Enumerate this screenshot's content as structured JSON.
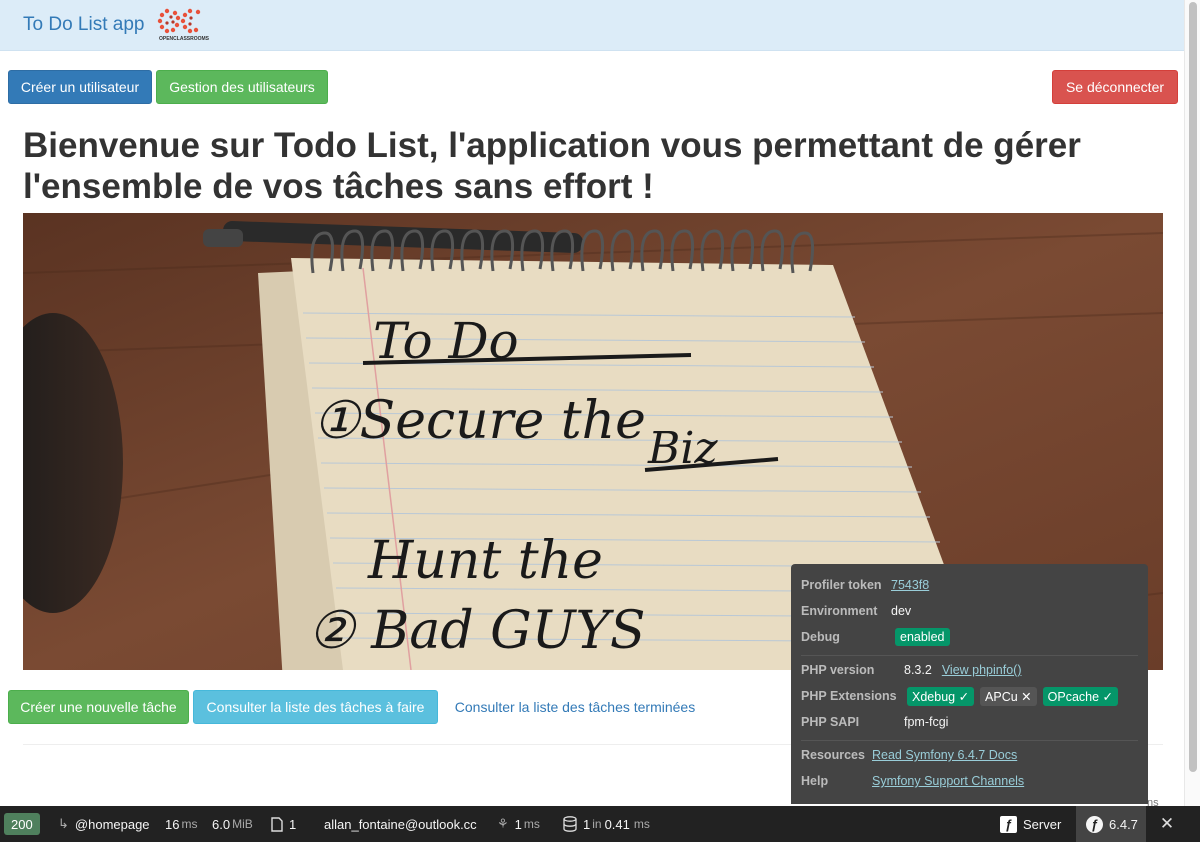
{
  "navbar": {
    "brand": "To Do List app",
    "logo_text": "OPENCLASSROOMS"
  },
  "actions": {
    "create_user": "Créer un utilisateur",
    "manage_users": "Gestion des utilisateurs",
    "logout": "Se déconnecter"
  },
  "main": {
    "title_line1": "Bienvenue sur Todo List, l'application vous permettant de gérer",
    "title_line2": "l'ensemble de vos tâches sans effort !",
    "image_text": {
      "line1": "To Do",
      "line2": "①Secure the",
      "line3": "Biz",
      "line4": "Hunt the",
      "line5": "② Bad GUYS"
    }
  },
  "task_actions": {
    "new_task": "Créer une nouvelle tâche",
    "todo_list": "Consulter la liste des tâches à faire",
    "done_list": "Consulter la liste des tâches terminées"
  },
  "footer_fragment": "ns",
  "profiler_panel": {
    "token_label": "Profiler token",
    "token_value": "7543f8",
    "environment_label": "Environment",
    "environment_value": "dev",
    "debug_label": "Debug",
    "debug_value": "enabled",
    "php_version_label": "PHP version",
    "php_version_value": "8.3.2",
    "phpinfo_link": "View phpinfo()",
    "php_extensions_label": "PHP Extensions",
    "extensions": [
      {
        "label": "Xdebug ✓",
        "status": "enabled"
      },
      {
        "label": "APCu ✕",
        "status": "disabled"
      },
      {
        "label": "OPcache ✓",
        "status": "enabled"
      }
    ],
    "php_sapi_label": "PHP SAPI",
    "php_sapi_value": "fpm-fcgi",
    "resources_label": "Resources",
    "resources_link": "Read Symfony 6.4.7 Docs",
    "help_label": "Help",
    "help_link": "Symfony Support Channels"
  },
  "toolbar": {
    "status_code": "200",
    "route": "@homepage",
    "time_value": "16",
    "time_unit": "ms",
    "memory_value": "6.0",
    "memory_unit": "MiB",
    "logs_count": "1",
    "user": "allan_fontaine@outlook.cc",
    "twig_value": "1",
    "twig_unit": "ms",
    "db_queries": "1",
    "db_in": "in",
    "db_time": "0.41",
    "db_unit": "ms",
    "server_label": "Server",
    "symfony_version": "6.4.7"
  },
  "colors": {
    "navbar_bg": "#dcecf8",
    "primary": "#337ab7",
    "success": "#5cb85c",
    "danger": "#d9534f",
    "info": "#5bc0de",
    "toolbar_bg": "#222222",
    "status_ok": "#4f805d",
    "badge_green": "#059669"
  }
}
